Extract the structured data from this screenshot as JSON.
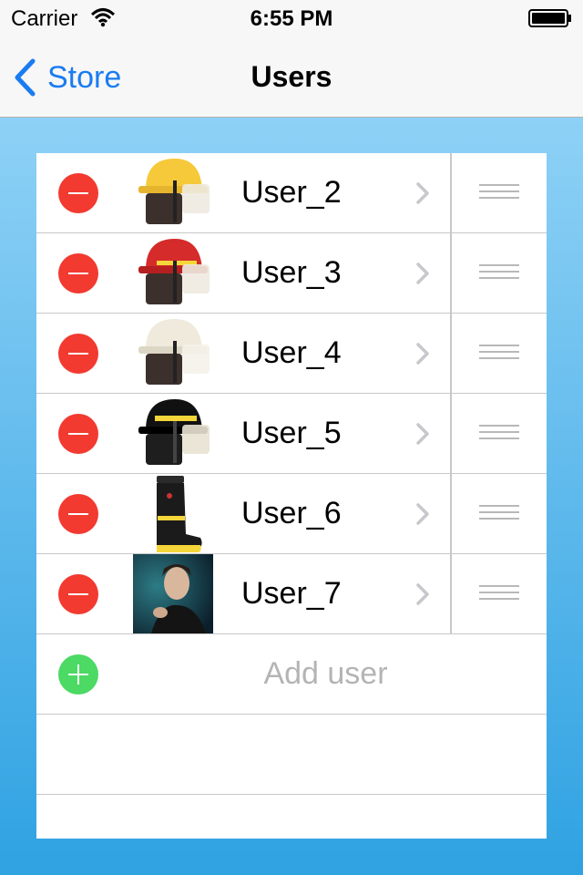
{
  "status_bar": {
    "carrier": "Carrier",
    "time": "6:55 PM",
    "icons": [
      "wifi-icon",
      "battery-icon"
    ]
  },
  "nav": {
    "back_label": "Store",
    "title": "Users",
    "tint_color": "#1a7cf2"
  },
  "users": [
    {
      "label": "User_2",
      "avatar": "yellow-helmet"
    },
    {
      "label": "User_3",
      "avatar": "red-helmet"
    },
    {
      "label": "User_4",
      "avatar": "white-helmet"
    },
    {
      "label": "User_5",
      "avatar": "black-helmet"
    },
    {
      "label": "User_6",
      "avatar": "fire-boot"
    },
    {
      "label": "User_7",
      "avatar": "portrait-photo"
    }
  ],
  "add_row": {
    "label": "Add user"
  },
  "colors": {
    "delete": "#f23a30",
    "add": "#4cd964",
    "background_top": "#8ed1f6",
    "background_bottom": "#2fa2e2"
  }
}
